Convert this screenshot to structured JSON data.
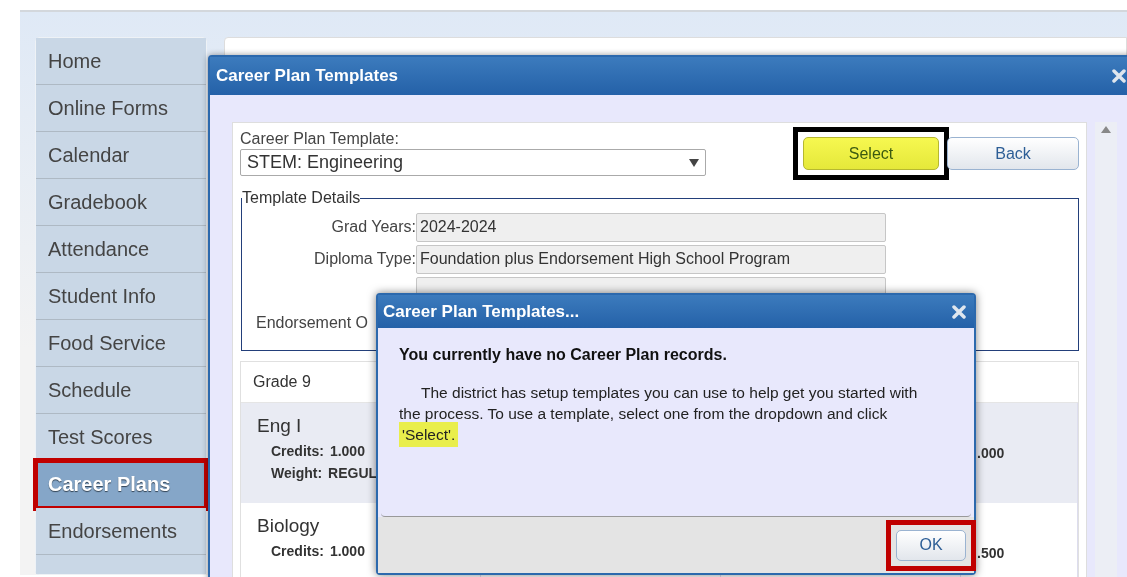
{
  "sidebar": {
    "items": [
      {
        "label": "Home",
        "selected": false,
        "highlighted": false
      },
      {
        "label": "Online Forms",
        "selected": false,
        "highlighted": false
      },
      {
        "label": "Calendar",
        "selected": false,
        "highlighted": false
      },
      {
        "label": "Gradebook",
        "selected": false,
        "highlighted": false
      },
      {
        "label": "Attendance",
        "selected": false,
        "highlighted": false
      },
      {
        "label": "Student Info",
        "selected": false,
        "highlighted": false
      },
      {
        "label": "Food Service",
        "selected": false,
        "highlighted": false
      },
      {
        "label": "Schedule",
        "selected": false,
        "highlighted": false
      },
      {
        "label": "Test Scores",
        "selected": false,
        "highlighted": false
      },
      {
        "label": "Career Plans",
        "selected": true,
        "highlighted": true
      },
      {
        "label": "Endorsements",
        "selected": false,
        "highlighted": false
      }
    ]
  },
  "dialog": {
    "title": "Career Plan Templates",
    "template_label": "Career Plan Template:",
    "template_value": "STEM: Engineering",
    "buttons": [
      {
        "label": "Select",
        "kind": "primary",
        "highlighted": true
      },
      {
        "label": "Back",
        "kind": "secondary",
        "highlighted": false
      }
    ],
    "details": {
      "legend": "Template Details",
      "rows": [
        {
          "label": "Grad Years:",
          "value": "2024-2024"
        },
        {
          "label": "Diploma Type:",
          "value": "Foundation plus Endorsement High School Program"
        },
        {
          "kind": "field"
        },
        {
          "label": "Endorsement O"
        }
      ]
    },
    "grade": {
      "title": "Grade 9",
      "courses": [
        {
          "name": "Eng I",
          "credits_label": "Credits:",
          "credits": "1.000",
          "weight_label": "Weight:",
          "weight": "REGUL",
          "column_4": ".000"
        },
        {
          "name": "Biology",
          "credits_label": "Credits:",
          "credits": "1.000",
          "column_4": ".500"
        }
      ]
    }
  },
  "message": {
    "title": "Career Plan Templates...",
    "heading": "You currently have no Career Plan records.",
    "text": "The district has setup templates you can use to help get you started with the process. To use a template, select one from the dropdown and click",
    "highlight": "'Select'.",
    "button": {
      "label": "OK",
      "highlighted": true
    }
  }
}
